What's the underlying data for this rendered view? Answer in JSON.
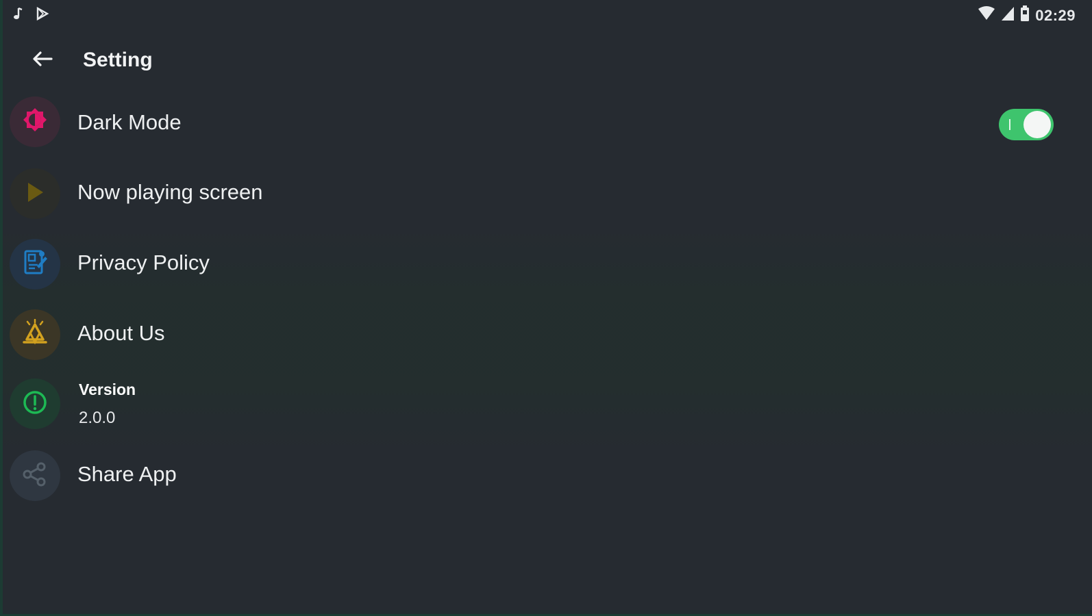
{
  "status_bar": {
    "time": "02:29",
    "notification_icons": [
      "music-note-icon",
      "play-store-icon"
    ],
    "system_icons": [
      "wifi-icon",
      "cell-signal-icon",
      "battery-icon"
    ]
  },
  "app_bar": {
    "title": "Setting"
  },
  "settings": {
    "dark_mode": {
      "label": "Dark Mode",
      "icon": "brightness-icon",
      "color": "#e0176a",
      "enabled": true
    },
    "now_playing": {
      "label": "Now playing screen",
      "icon": "play-icon",
      "color": "#6a5a12"
    },
    "privacy": {
      "label": "Privacy Policy",
      "icon": "policy-document-icon",
      "color": "#1f7dc4"
    },
    "about": {
      "label": "About Us",
      "icon": "about-bell-icon",
      "color": "#d2a11f"
    },
    "version": {
      "title": "Version",
      "value": "2.0.0",
      "icon": "info-icon",
      "color": "#1db954"
    },
    "share": {
      "label": "Share App",
      "icon": "share-icon",
      "color": "#55606a"
    }
  },
  "colors": {
    "background": "#262b31",
    "toggle_on": "#3ec46d"
  }
}
